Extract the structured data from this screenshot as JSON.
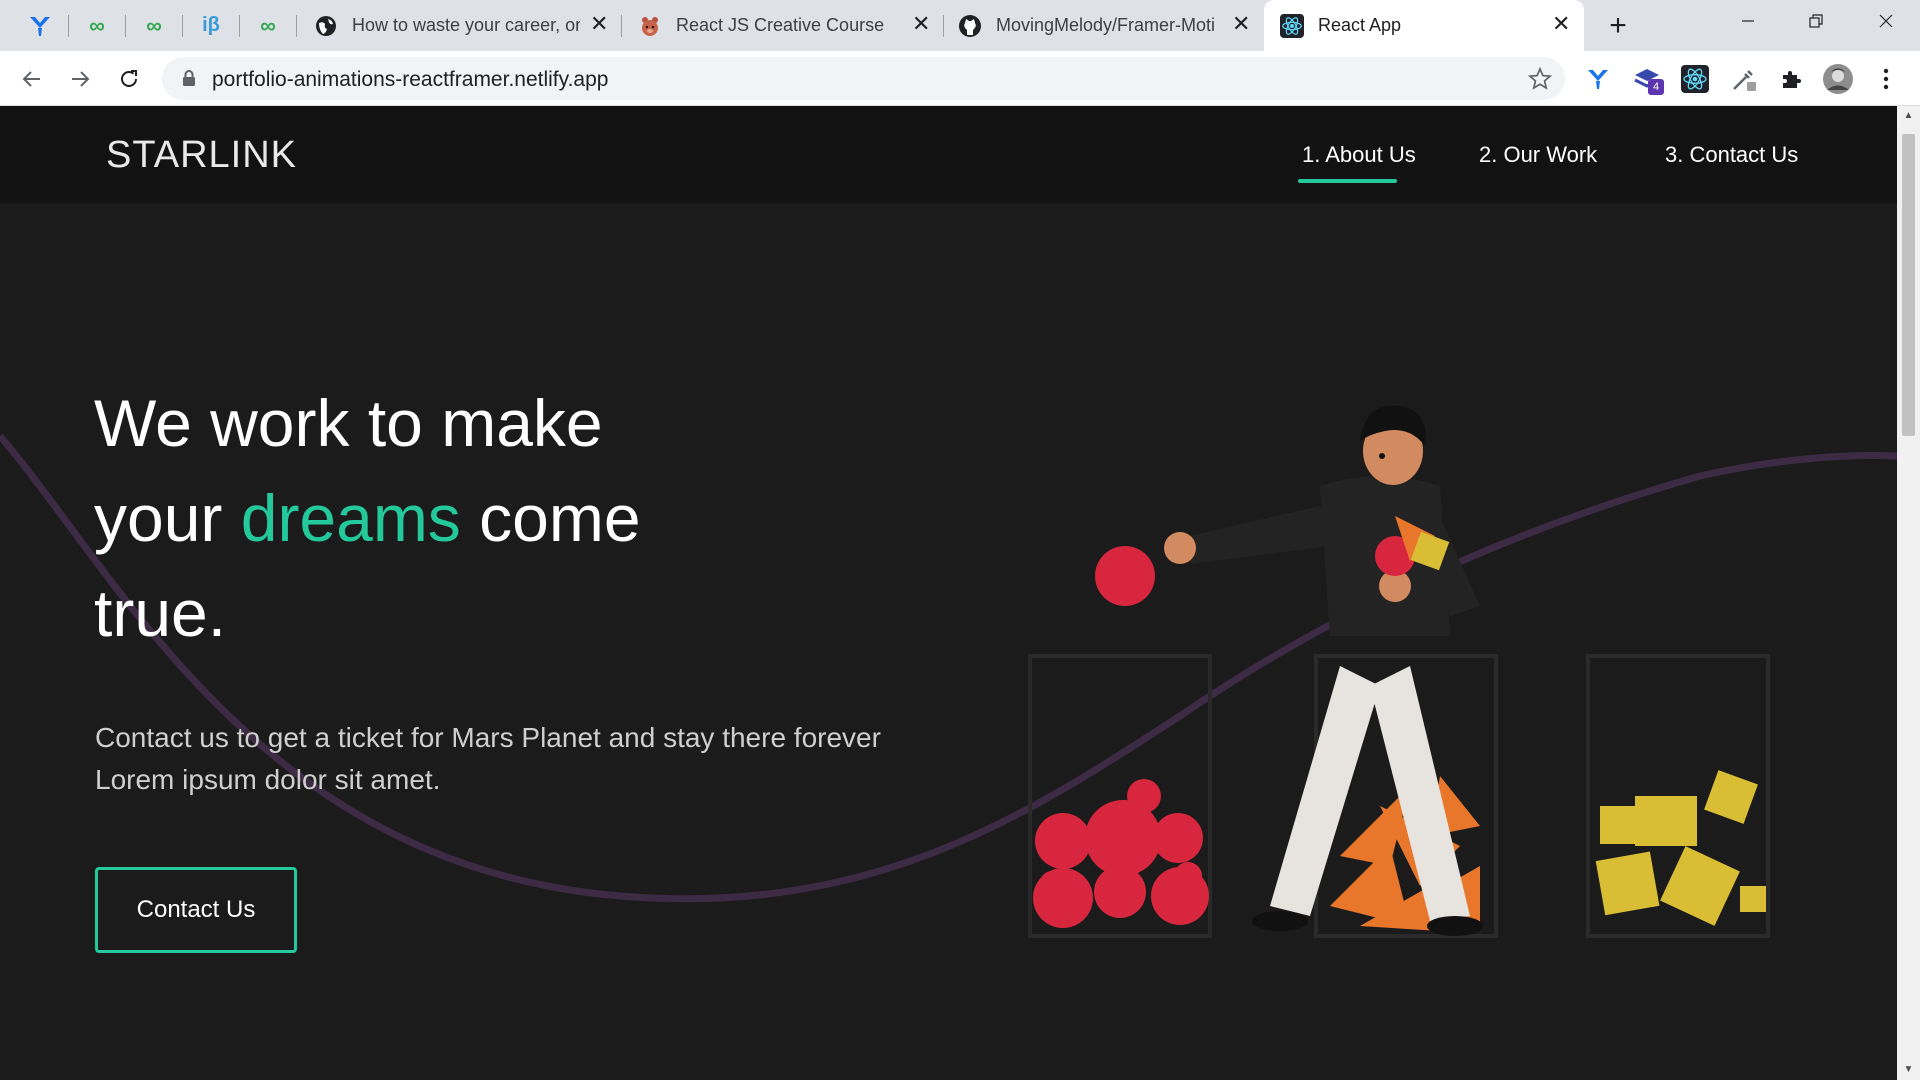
{
  "browser": {
    "tabs": [
      {
        "title": "How to waste your career, one",
        "favicon": "globe-icon"
      },
      {
        "title": "React JS Creative Course",
        "favicon": "bear-icon"
      },
      {
        "title": "MovingMelody/Framer-Moti",
        "favicon": "github-icon"
      },
      {
        "title": "React App",
        "favicon": "react-icon",
        "active": true
      }
    ],
    "pinned_tabs": [
      "y-icon",
      "infinity-icon",
      "infinity-icon",
      "ib-icon",
      "infinity-icon"
    ],
    "new_tab": "+",
    "url": "portfolio-animations-reactframer.netlify.app",
    "extension_badge": "4"
  },
  "site": {
    "logo": "STARLINK",
    "nav": [
      "1. About Us",
      "2. Our Work",
      "3. Contact Us"
    ],
    "hero": {
      "line1": "We work to make",
      "line2_before": "your ",
      "line2_accent": "dreams",
      "line2_after": " come",
      "line3": "true.",
      "description": "Contact us to get a ticket for Mars Planet and stay there forever Lorem ipsum dolor sit amet.",
      "cta": "Contact Us"
    },
    "colors": {
      "accent": "#23c99a",
      "background": "#1b1b1c",
      "header": "#121212",
      "wave": "#3d2a45"
    }
  }
}
